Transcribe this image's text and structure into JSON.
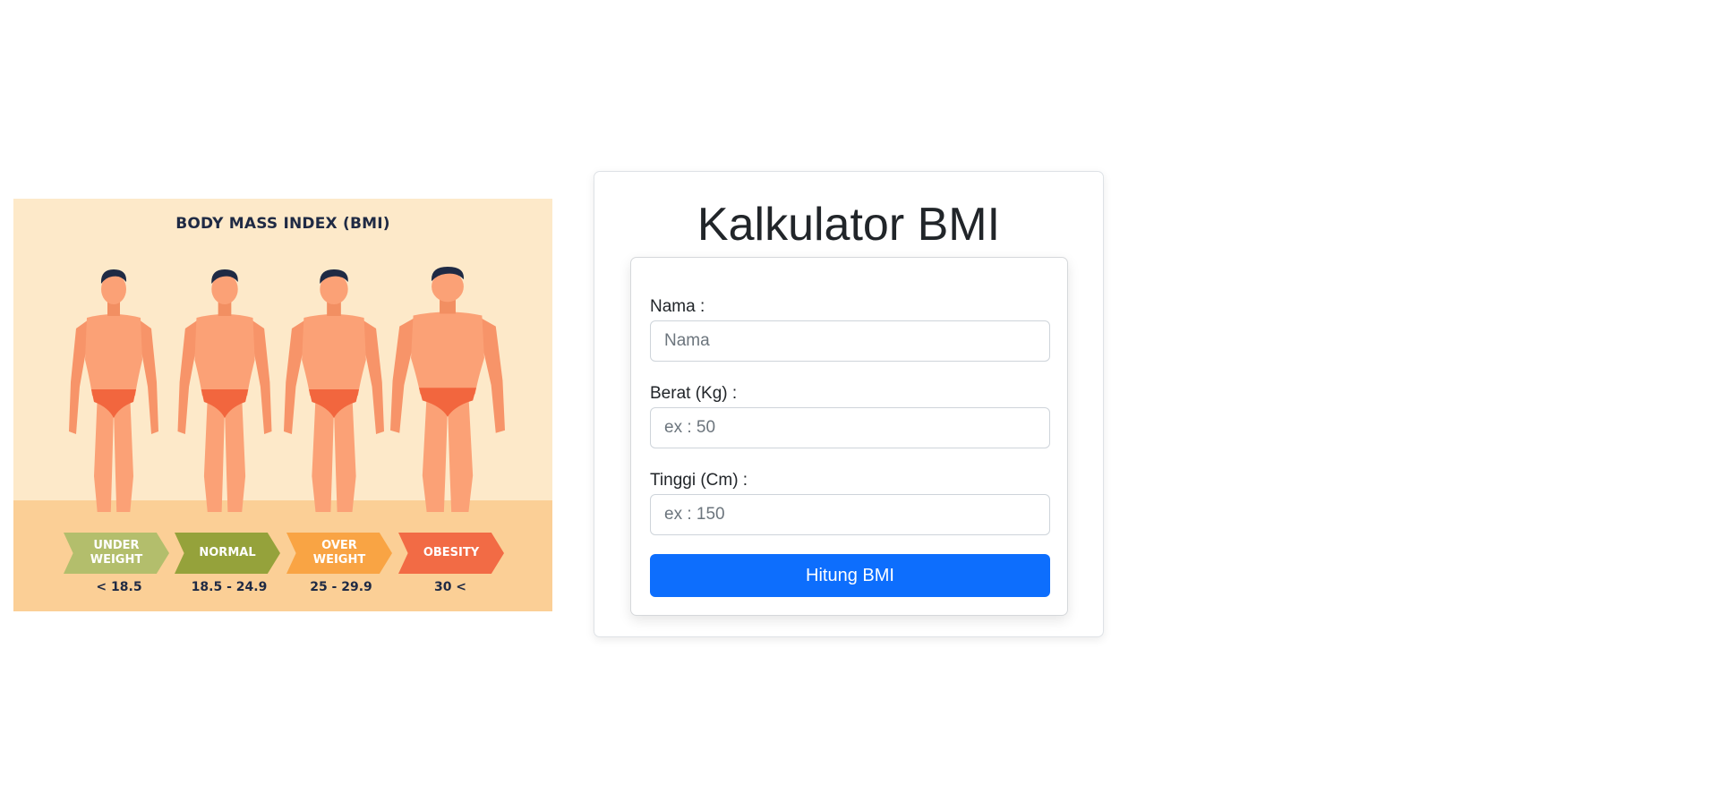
{
  "poster": {
    "title": "BODY MASS INDEX (BMI)",
    "categories": [
      {
        "label": "UNDER\nWEIGHT",
        "range": "< 18.5",
        "color": "#b3be6c"
      },
      {
        "label": "NORMAL",
        "range": "18.5 - 24.9",
        "color": "#95a23b"
      },
      {
        "label": "OVER\nWEIGHT",
        "range": "25 - 29.9",
        "color": "#f9a444"
      },
      {
        "label": "OBESITY",
        "range": "30 <",
        "color": "#f26b45"
      }
    ],
    "colors": {
      "background": "#fde9c9",
      "floor": "#fbcf96",
      "skin": "#fba176",
      "underwear": "#f2663e",
      "hair": "#1f2a44"
    }
  },
  "calculator": {
    "title": "Kalkulator BMI",
    "fields": {
      "name": {
        "label": "Nama :",
        "placeholder": "Nama",
        "value": ""
      },
      "weight": {
        "label": "Berat (Kg) :",
        "placeholder": "ex : 50",
        "value": ""
      },
      "height": {
        "label": "Tinggi (Cm) :",
        "placeholder": "ex : 150",
        "value": ""
      }
    },
    "submit_label": "Hitung BMI",
    "accent_color": "#0d6efd"
  }
}
